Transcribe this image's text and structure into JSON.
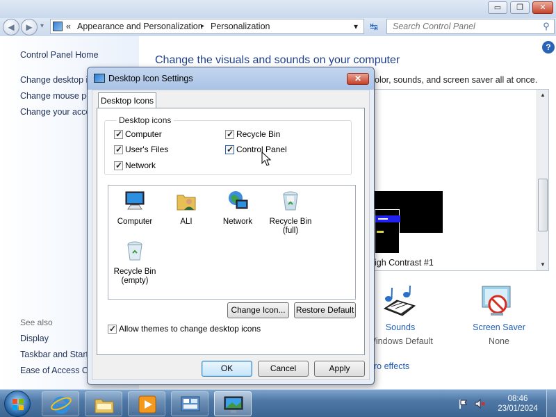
{
  "window": {
    "minimize_glyph": "▭",
    "maximize_glyph": "❐",
    "close_glyph": "✕"
  },
  "nav": {
    "back_glyph": "◀",
    "forward_glyph": "▶",
    "history_glyph": "▾",
    "address_prefix": "«",
    "breadcrumb": [
      "Appearance and Personalization",
      "Personalization"
    ],
    "breadcrumb_sep": "▸",
    "address_dropdown_glyph": "▾",
    "refresh_glyph": "↹",
    "search_placeholder": "Search Control Panel",
    "search_glyph": "⚲"
  },
  "left_pane": {
    "links": [
      "Control Panel Home",
      "Change desktop icons",
      "Change mouse pointers",
      "Change your account picture"
    ],
    "see_also_label": "See also",
    "see_also": [
      "Display",
      "Taskbar and Start Menu",
      "Ease of Access Center"
    ]
  },
  "main": {
    "heading": "Change the visuals and sounds on your computer",
    "subtitle_fragment": "olor, sounds, and screen saver all at once.",
    "help_glyph": "?",
    "theme_name_fragment": "igh Contrast #1",
    "scroll_up": "▲",
    "scroll_down": "▼",
    "bottom_items": [
      {
        "label": "Sounds",
        "sub": "Windows Default"
      },
      {
        "label": "Screen Saver",
        "sub": "None"
      }
    ],
    "effects_fragment": "ro effects"
  },
  "dialog": {
    "title": "Desktop Icon Settings",
    "close_glyph": "✕",
    "tab": "Desktop Icons",
    "group_label": "Desktop icons",
    "checkboxes": [
      {
        "label": "Computer",
        "checked": true
      },
      {
        "label": "Recycle Bin",
        "checked": true
      },
      {
        "label": "User's Files",
        "checked": true
      },
      {
        "label": "Control Panel",
        "checked": true
      },
      {
        "label": "Network",
        "checked": true
      }
    ],
    "icons": [
      {
        "label": "Computer",
        "icon": "computer-icon"
      },
      {
        "label": "ALI",
        "icon": "user-folder-icon"
      },
      {
        "label": "Network",
        "icon": "network-icon"
      },
      {
        "label": "Recycle Bin\n(full)",
        "icon": "recycle-bin-full-icon"
      },
      {
        "label": "Recycle Bin\n(empty)",
        "icon": "recycle-bin-empty-icon"
      }
    ],
    "change_icon_button": "Change Icon...",
    "restore_default_button": "Restore Default",
    "allow_themes_label": "Allow themes to change desktop icons",
    "allow_themes_checked": true,
    "ok_button": "OK",
    "cancel_button": "Cancel",
    "apply_button": "Apply"
  },
  "taskbar": {
    "apps": [
      "internet-explorer-icon",
      "windows-explorer-icon",
      "media-player-icon",
      "control-panel-icon",
      "desktop-icon-settings-icon"
    ],
    "time": "08:46",
    "date": "23/01/2024"
  },
  "colors": {
    "link_blue": "#1e5bb4",
    "heading_blue": "#1e3f8a",
    "taskbar": "#4f78a6"
  }
}
